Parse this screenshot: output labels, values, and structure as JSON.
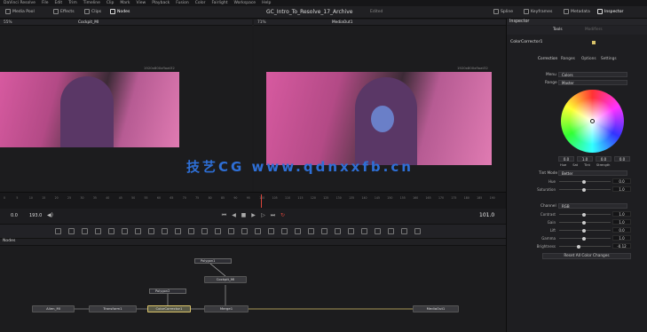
{
  "menubar": {
    "items": [
      "DaVinci Resolve",
      "File",
      "Edit",
      "Trim",
      "Timeline",
      "Clip",
      "Mark",
      "View",
      "Playback",
      "Fusion",
      "Color",
      "Fairlight",
      "Workspace",
      "Help"
    ]
  },
  "toolbar": {
    "media_pool": "Media Pool",
    "effects": "Effects",
    "clips": "Clips",
    "nodes": "Nodes",
    "project_title": "GC_Intro_To_Resolve_17_Archive",
    "edited": "Edited",
    "spline": "Spline",
    "keyframes": "Keyframes",
    "metadata": "Metadata",
    "inspector": "Inspector"
  },
  "viewer_left": {
    "zoom": "55%",
    "name": "Cockpit_MI",
    "resolution": "1920x800xfloat32"
  },
  "viewer_right": {
    "zoom": "71%",
    "name": "MediaOut1",
    "resolution": "1920x800xfloat32"
  },
  "watermark": "技艺CG  www.qdnxxfb.cn",
  "transport": {
    "start": "0.0",
    "end": "193.0",
    "current": "101.0"
  },
  "timeline": {
    "ticks": [
      "0",
      "5",
      "10",
      "15",
      "20",
      "25",
      "30",
      "35",
      "40",
      "45",
      "50",
      "55",
      "60",
      "65",
      "70",
      "75",
      "80",
      "85",
      "90",
      "95",
      "100",
      "105",
      "110",
      "115",
      "120",
      "125",
      "130",
      "135",
      "140",
      "145",
      "150",
      "155",
      "160",
      "165",
      "170",
      "175",
      "180",
      "185",
      "190"
    ]
  },
  "nodes_panel": {
    "title": "Nodes",
    "nodes": {
      "alien": "Alien_MI",
      "transform": "Transform1",
      "color": "ColorCorrector1",
      "merge": "Merge1",
      "media_out": "MediaOut1",
      "cockpit": "Cockpit_MI",
      "polygon1": "Polygon1",
      "polygon2": "Polygon2"
    }
  },
  "inspector": {
    "title": "Inspector",
    "tabs": {
      "tools": "Tools",
      "modifiers": "Modifiers"
    },
    "node_name": "ColorCorrector1",
    "subtabs": [
      "Correction",
      "Ranges",
      "Options",
      "Settings"
    ],
    "menu_label": "Menu",
    "menu_value": "Colors",
    "range_label": "Range",
    "range_value": "Master",
    "wheel_values": [
      "0.0",
      "1.0",
      "0.0",
      "0.0"
    ],
    "wheel_labels": [
      "Hue",
      "Sat",
      "Tint",
      "Strength"
    ],
    "tint_mode_label": "Tint Mode",
    "tint_mode_value": "Better",
    "hue_label": "Hue",
    "hue_value": "0.0",
    "saturation_label": "Saturation",
    "saturation_value": "1.0",
    "channel_label": "Channel",
    "channel_value": "RGB",
    "contrast_label": "Contrast",
    "contrast_value": "1.0",
    "gain_label": "Gain",
    "gain_value": "1.0",
    "lift_label": "Lift",
    "lift_value": "0.0",
    "gamma_label": "Gamma",
    "gamma_value": "1.0",
    "brightness_label": "Brightness",
    "brightness_value": "-0.12",
    "reset_label": "Reset All Color Changes"
  },
  "colors": {
    "accent": "#d9c36a",
    "selected_node_border": "#d9c36a",
    "play_red": "#d9453a"
  }
}
